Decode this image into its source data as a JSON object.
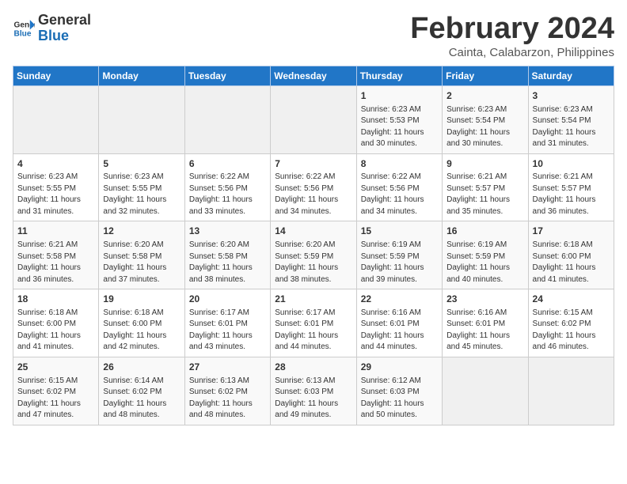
{
  "header": {
    "month_title": "February 2024",
    "subtitle": "Cainta, Calabarzon, Philippines",
    "logo_line1": "General",
    "logo_line2": "Blue"
  },
  "days_of_week": [
    "Sunday",
    "Monday",
    "Tuesday",
    "Wednesday",
    "Thursday",
    "Friday",
    "Saturday"
  ],
  "weeks": [
    [
      {
        "day": "",
        "info": ""
      },
      {
        "day": "",
        "info": ""
      },
      {
        "day": "",
        "info": ""
      },
      {
        "day": "",
        "info": ""
      },
      {
        "day": "1",
        "info": "Sunrise: 6:23 AM\nSunset: 5:53 PM\nDaylight: 11 hours and 30 minutes."
      },
      {
        "day": "2",
        "info": "Sunrise: 6:23 AM\nSunset: 5:54 PM\nDaylight: 11 hours and 30 minutes."
      },
      {
        "day": "3",
        "info": "Sunrise: 6:23 AM\nSunset: 5:54 PM\nDaylight: 11 hours and 31 minutes."
      }
    ],
    [
      {
        "day": "4",
        "info": "Sunrise: 6:23 AM\nSunset: 5:55 PM\nDaylight: 11 hours and 31 minutes."
      },
      {
        "day": "5",
        "info": "Sunrise: 6:23 AM\nSunset: 5:55 PM\nDaylight: 11 hours and 32 minutes."
      },
      {
        "day": "6",
        "info": "Sunrise: 6:22 AM\nSunset: 5:56 PM\nDaylight: 11 hours and 33 minutes."
      },
      {
        "day": "7",
        "info": "Sunrise: 6:22 AM\nSunset: 5:56 PM\nDaylight: 11 hours and 34 minutes."
      },
      {
        "day": "8",
        "info": "Sunrise: 6:22 AM\nSunset: 5:56 PM\nDaylight: 11 hours and 34 minutes."
      },
      {
        "day": "9",
        "info": "Sunrise: 6:21 AM\nSunset: 5:57 PM\nDaylight: 11 hours and 35 minutes."
      },
      {
        "day": "10",
        "info": "Sunrise: 6:21 AM\nSunset: 5:57 PM\nDaylight: 11 hours and 36 minutes."
      }
    ],
    [
      {
        "day": "11",
        "info": "Sunrise: 6:21 AM\nSunset: 5:58 PM\nDaylight: 11 hours and 36 minutes."
      },
      {
        "day": "12",
        "info": "Sunrise: 6:20 AM\nSunset: 5:58 PM\nDaylight: 11 hours and 37 minutes."
      },
      {
        "day": "13",
        "info": "Sunrise: 6:20 AM\nSunset: 5:58 PM\nDaylight: 11 hours and 38 minutes."
      },
      {
        "day": "14",
        "info": "Sunrise: 6:20 AM\nSunset: 5:59 PM\nDaylight: 11 hours and 38 minutes."
      },
      {
        "day": "15",
        "info": "Sunrise: 6:19 AM\nSunset: 5:59 PM\nDaylight: 11 hours and 39 minutes."
      },
      {
        "day": "16",
        "info": "Sunrise: 6:19 AM\nSunset: 5:59 PM\nDaylight: 11 hours and 40 minutes."
      },
      {
        "day": "17",
        "info": "Sunrise: 6:18 AM\nSunset: 6:00 PM\nDaylight: 11 hours and 41 minutes."
      }
    ],
    [
      {
        "day": "18",
        "info": "Sunrise: 6:18 AM\nSunset: 6:00 PM\nDaylight: 11 hours and 41 minutes."
      },
      {
        "day": "19",
        "info": "Sunrise: 6:18 AM\nSunset: 6:00 PM\nDaylight: 11 hours and 42 minutes."
      },
      {
        "day": "20",
        "info": "Sunrise: 6:17 AM\nSunset: 6:01 PM\nDaylight: 11 hours and 43 minutes."
      },
      {
        "day": "21",
        "info": "Sunrise: 6:17 AM\nSunset: 6:01 PM\nDaylight: 11 hours and 44 minutes."
      },
      {
        "day": "22",
        "info": "Sunrise: 6:16 AM\nSunset: 6:01 PM\nDaylight: 11 hours and 44 minutes."
      },
      {
        "day": "23",
        "info": "Sunrise: 6:16 AM\nSunset: 6:01 PM\nDaylight: 11 hours and 45 minutes."
      },
      {
        "day": "24",
        "info": "Sunrise: 6:15 AM\nSunset: 6:02 PM\nDaylight: 11 hours and 46 minutes."
      }
    ],
    [
      {
        "day": "25",
        "info": "Sunrise: 6:15 AM\nSunset: 6:02 PM\nDaylight: 11 hours and 47 minutes."
      },
      {
        "day": "26",
        "info": "Sunrise: 6:14 AM\nSunset: 6:02 PM\nDaylight: 11 hours and 48 minutes."
      },
      {
        "day": "27",
        "info": "Sunrise: 6:13 AM\nSunset: 6:02 PM\nDaylight: 11 hours and 48 minutes."
      },
      {
        "day": "28",
        "info": "Sunrise: 6:13 AM\nSunset: 6:03 PM\nDaylight: 11 hours and 49 minutes."
      },
      {
        "day": "29",
        "info": "Sunrise: 6:12 AM\nSunset: 6:03 PM\nDaylight: 11 hours and 50 minutes."
      },
      {
        "day": "",
        "info": ""
      },
      {
        "day": "",
        "info": ""
      }
    ]
  ]
}
